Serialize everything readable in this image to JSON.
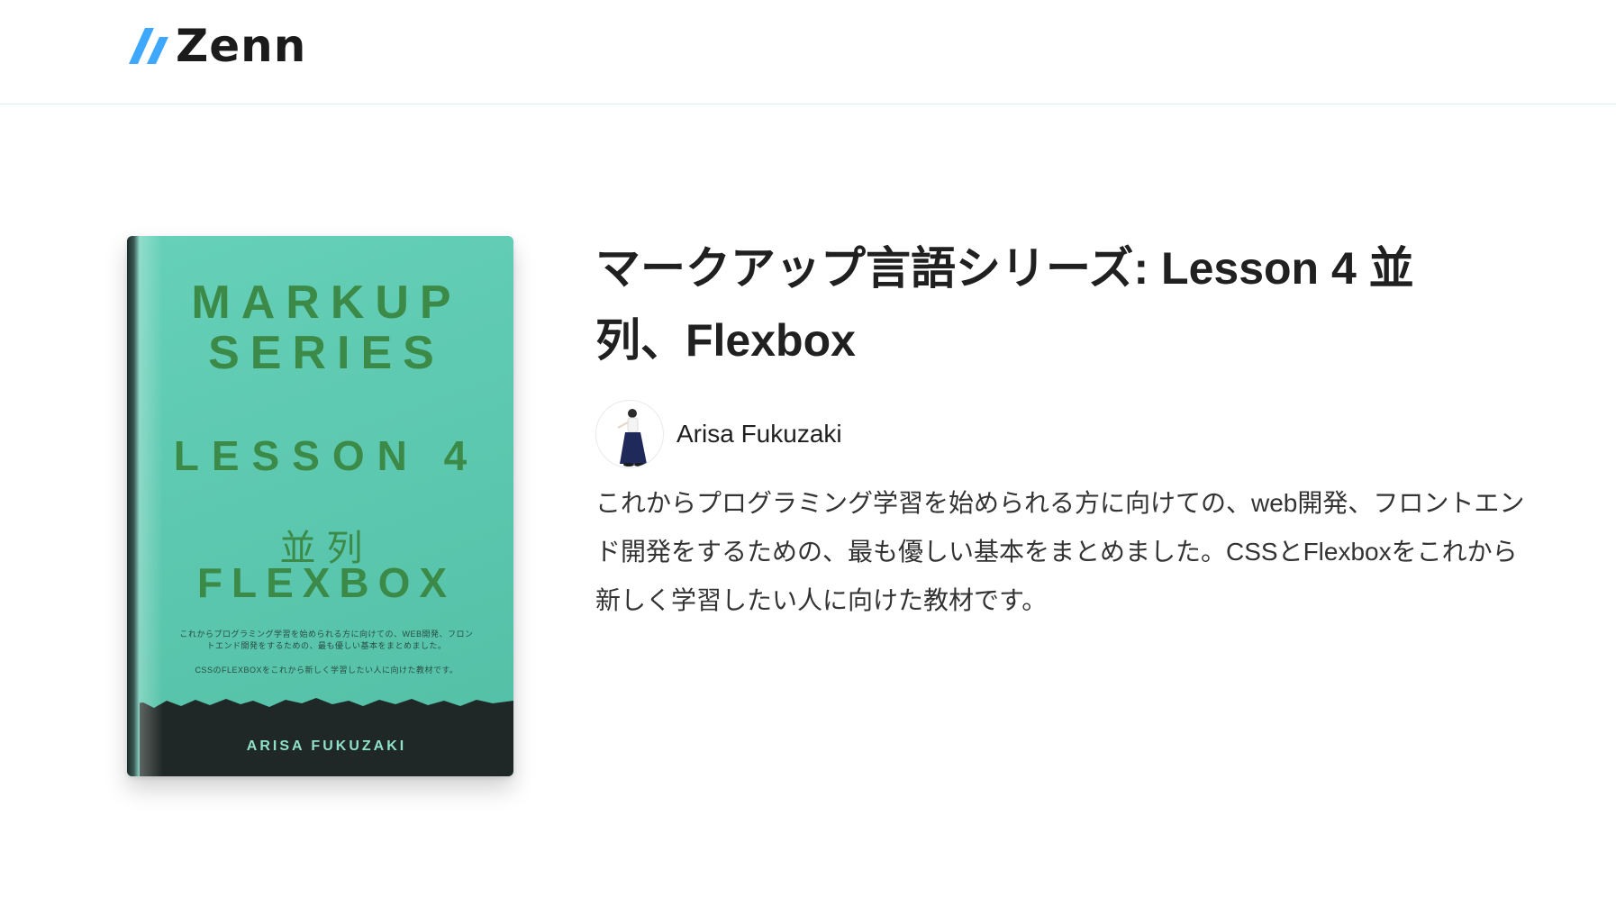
{
  "header": {
    "logo_text": "Zenn",
    "logo_colors": [
      "#3ea8ff",
      "#3ea8ff"
    ]
  },
  "book": {
    "cover": {
      "series_line1": "MARKUP",
      "series_line2": "SERIES",
      "lesson": "LESSON 4",
      "kanji": "並列",
      "flexbox": "FLEXBOX",
      "desc_line1": "これからプログラミング学習を始められる方に向けての、WEB開発、フロントエンド開発をするための、最も優しい基本をまとめました。",
      "desc_line2": "CSSのFLEXBOXをこれから新しく学習したい人に向けた教材です。",
      "author": "ARISA FUKUZAKI",
      "background_color": "#5ac6ad",
      "text_color": "#3c8a48",
      "bottom_color": "#1f2826"
    },
    "title": "マークアップ言語シリーズ: Lesson 4 並列、Flexbox",
    "author_name": "Arisa Fukuzaki",
    "description": "これからプログラミング学習を始められる方に向けての、web開発、フロントエンド開発をするための、最も優しい基本をまとめました。CSSとFlexboxをこれから新しく学習したい人に向けた教材です。"
  }
}
